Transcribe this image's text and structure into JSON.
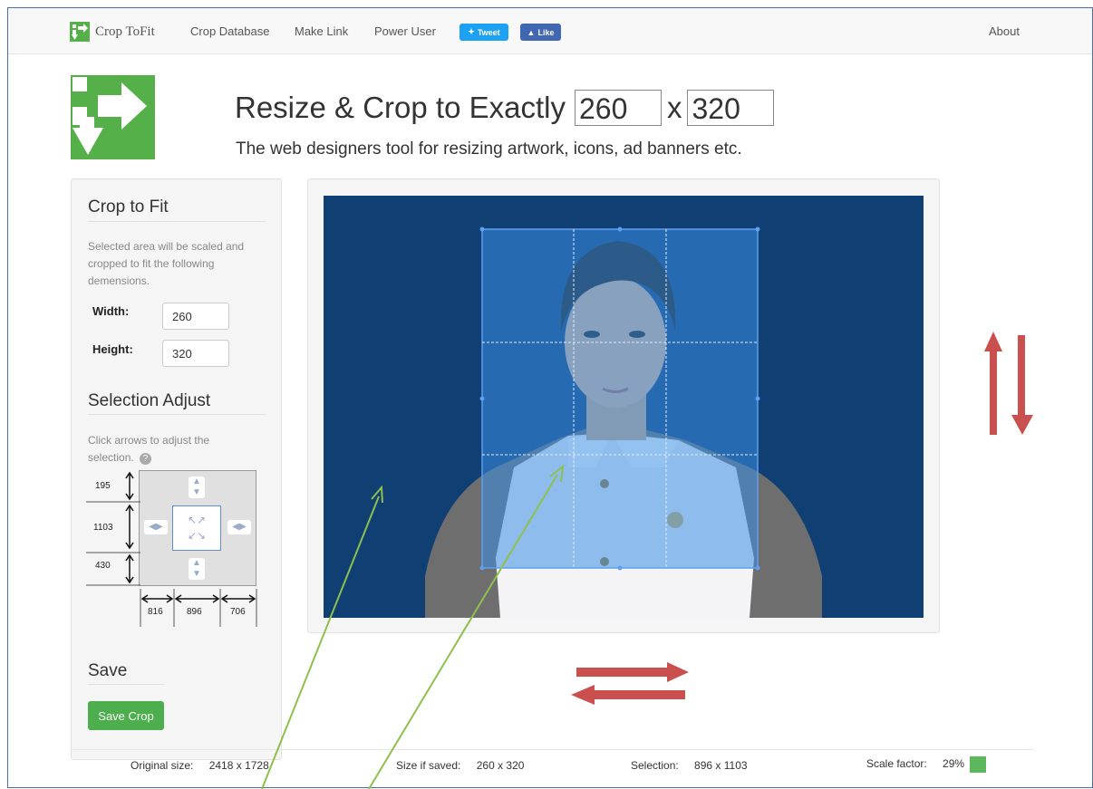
{
  "navbar": {
    "brand": "Crop ToFit",
    "links": [
      "Crop Database",
      "Make Link",
      "Power User"
    ],
    "tweet": "Tweet",
    "like": "Like",
    "about": "About"
  },
  "header": {
    "title_prefix": "Resize & Crop to Exactly",
    "width": "260",
    "separator": "x",
    "height": "320",
    "subtitle": "The web designers tool for resizing artwork, icons, ad banners etc."
  },
  "sidebar": {
    "crop_title": "Crop to Fit",
    "crop_help": "Selected area will be scaled and cropped to fit the following demensions.",
    "width_label": "Width:",
    "width_value": "260",
    "height_label": "Height:",
    "height_value": "320",
    "adjust_title": "Selection Adjust",
    "adjust_help": "Click arrows to adjust the selection.",
    "adjust_top": "195",
    "adjust_middle": "1103",
    "adjust_bottom": "430",
    "adjust_left": "816",
    "adjust_center": "896",
    "adjust_right": "706",
    "save_title": "Save",
    "save_button": "Save Crop"
  },
  "status": {
    "original_label": "Original size:",
    "original_value": "2418 x 1728",
    "saved_label": "Size if saved:",
    "saved_value": "260 x 320",
    "selection_label": "Selection:",
    "selection_value": "896 x 1103",
    "scale_label": "Scale factor:",
    "scale_value": "29%"
  },
  "colors": {
    "logo_green": "#55b04a",
    "photo_background": "#0f3f73",
    "selection_blue": "#3b8fe6",
    "annotation_red": "#c9504f",
    "annotation_green": "#8fbf4d"
  }
}
